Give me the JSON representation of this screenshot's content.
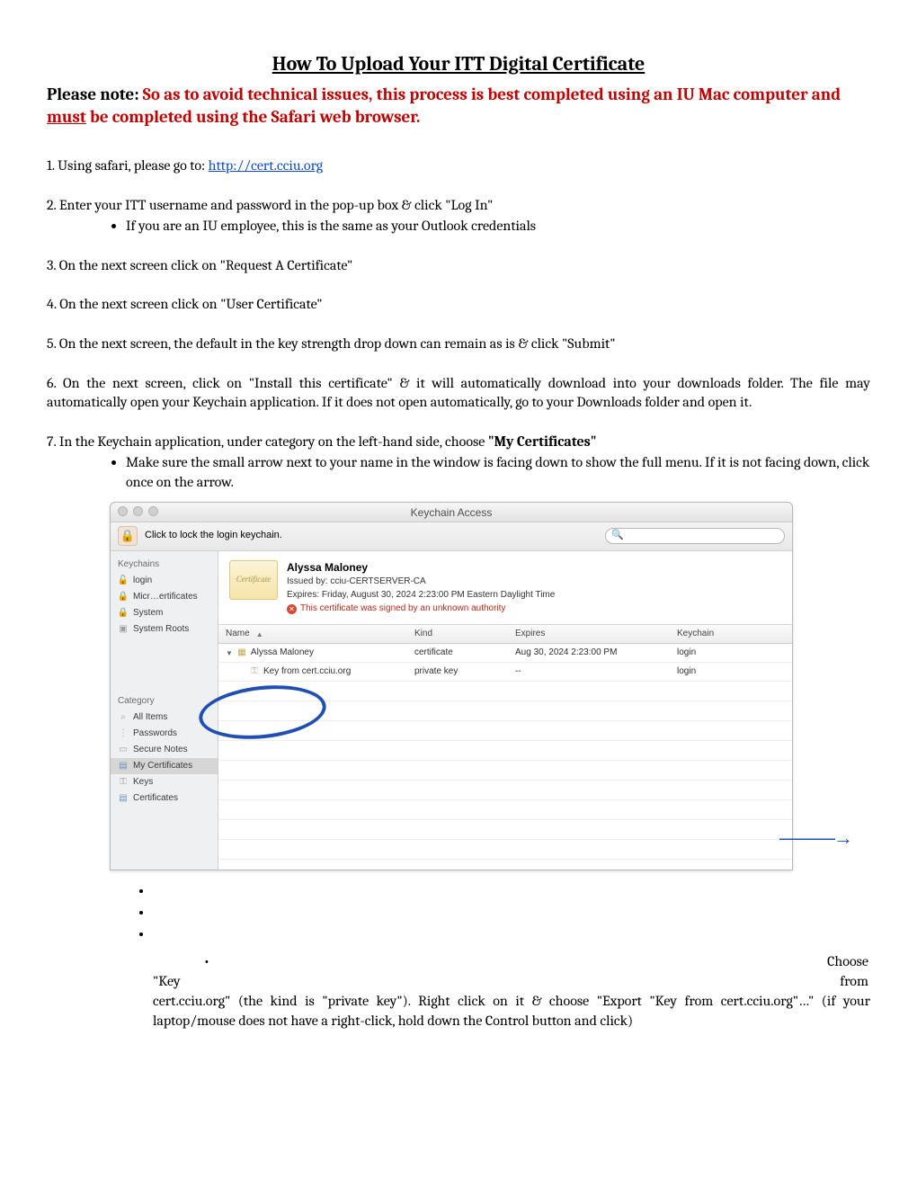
{
  "title": "How To Upload Your ITT Digital Certificate",
  "note": {
    "prefix": "Please note: ",
    "red1": "So as to avoid technical issues, this process is best completed using an IU Mac computer and ",
    "must": "must",
    "red2": " be completed using the Safari web browser."
  },
  "steps": {
    "s1a": "1. Using safari, please go to: ",
    "s1link": "http://cert.cciu.org",
    "s2": "2. Enter your ITT username and password in the pop-up box & click \"Log In\"",
    "s2b": "If you are an IU employee, this is the same as your Outlook credentials",
    "s3": "3. On the next screen click on \"Request A Certificate\"",
    "s4": "4. On the next screen click on \"User Certificate\"",
    "s5": "5. On the next screen, the default in the key strength drop down can remain as is & click \"Submit\"",
    "s6": "6. On the next screen, click on \"Install this certificate\" & it will automatically download into your downloads folder. The file may automatically open your Keychain application. If it does not open automatically, go to your Downloads folder and open it.",
    "s7a": "7. In the Keychain application, under category on the left-hand side, choose ",
    "s7b": "\"My Certificates\"",
    "s7bul": "Make sure the small arrow next to your name in the window is facing down to show the full menu. If it is not facing down, click once on the arrow."
  },
  "keychain": {
    "title": "Keychain Access",
    "locktext": "Click to lock the login keychain.",
    "sidebar": {
      "header1": "Keychains",
      "items1": [
        "login",
        "Micr…ertificates",
        "System",
        "System Roots"
      ],
      "header2": "Category",
      "items2": [
        "All Items",
        "Passwords",
        "Secure Notes",
        "My Certificates",
        "Keys",
        "Certificates"
      ]
    },
    "cert": {
      "thumb": "Certificate",
      "name": "Alyssa Maloney",
      "issued": "Issued by: cciu-CERTSERVER-CA",
      "expires": "Expires: Friday, August 30, 2024 2:23:00 PM Eastern Daylight Time",
      "warn": "This certificate was signed by an unknown authority"
    },
    "columns": {
      "name": "Name",
      "kind": "Kind",
      "expires": "Expires",
      "keychain": "Keychain"
    },
    "rows": [
      {
        "name": "Alyssa Maloney",
        "kind": "certificate",
        "expires": "Aug 30, 2024 2:23:00 PM",
        "keychain": "login",
        "icon": "cert"
      },
      {
        "name": "Key from cert.cciu.org",
        "kind": "private key",
        "expires": "--",
        "keychain": "login",
        "icon": "key"
      }
    ]
  },
  "tail": {
    "right1": "Choose",
    "left2": "\"Key",
    "right2": "from",
    "para": "cert.cciu.org\" (the kind is \"private key\"). Right click on it & choose \"Export \"Key from cert.cciu.org\"…\" (if your laptop/mouse does not have a right-click, hold down the Control button and click)"
  }
}
